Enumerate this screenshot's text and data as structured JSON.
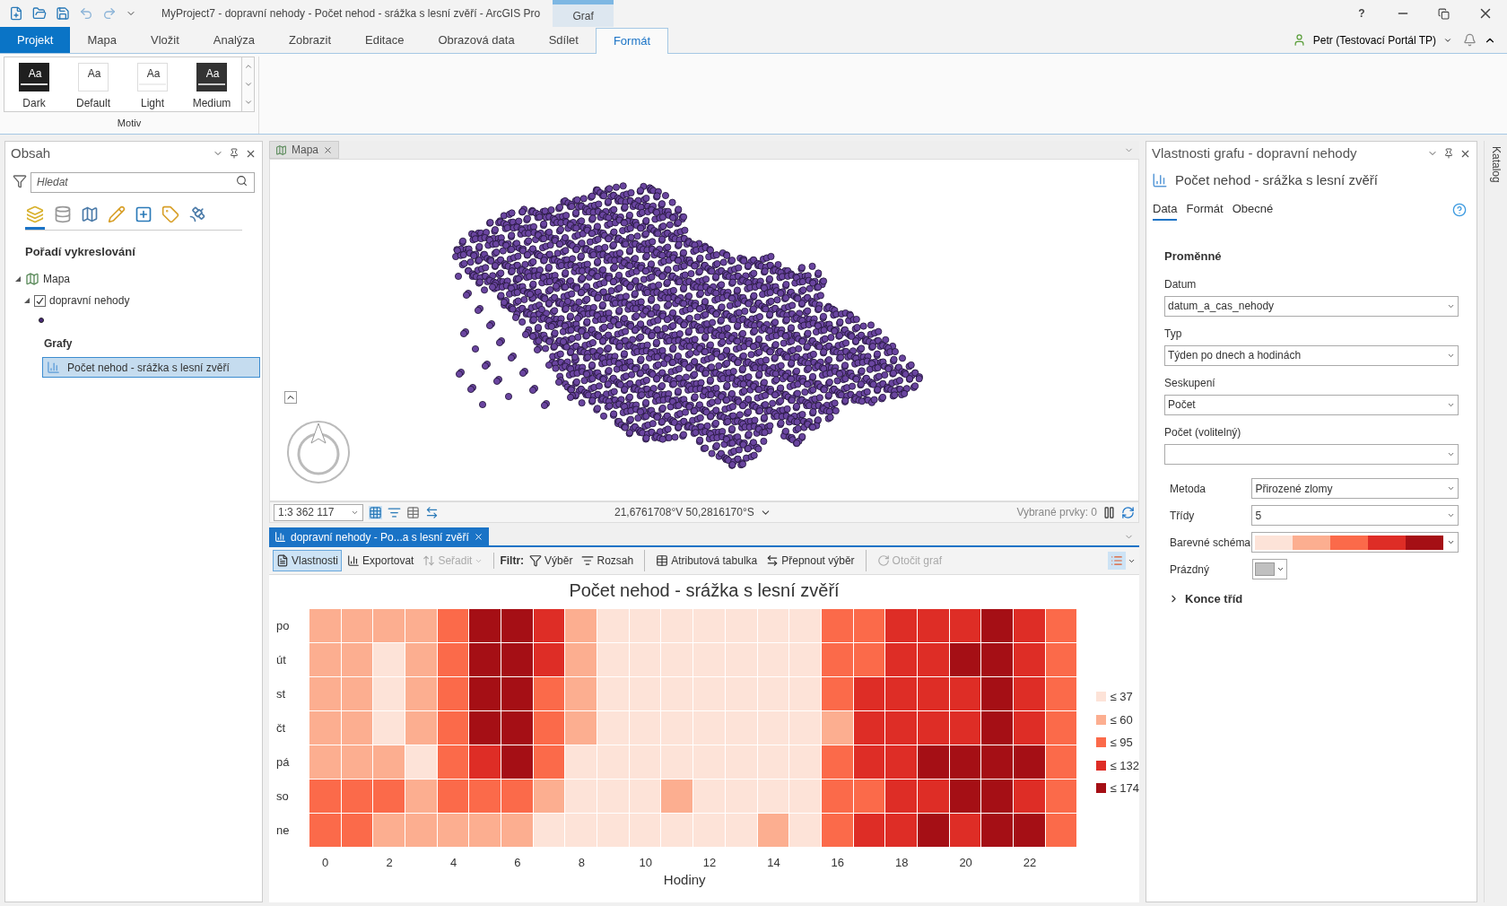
{
  "title_bar": {
    "title": "MyProject7 - dopravní nehody - Počet nehod - srážka s lesní zvěří - ArcGIS Pro",
    "context_tab": "Graf",
    "help": "?"
  },
  "ribbon": {
    "tabs": [
      {
        "label": "Projekt",
        "kind": "backstage",
        "selected": false
      },
      {
        "label": "Mapa",
        "kind": "tab",
        "selected": false
      },
      {
        "label": "Vložit",
        "kind": "tab",
        "selected": false
      },
      {
        "label": "Analýza",
        "kind": "tab",
        "selected": false
      },
      {
        "label": "Zobrazit",
        "kind": "tab",
        "selected": false
      },
      {
        "label": "Editace",
        "kind": "tab",
        "selected": false
      },
      {
        "label": "Obrazová data",
        "kind": "tab",
        "selected": false
      },
      {
        "label": "Sdílet",
        "kind": "tab",
        "selected": false
      },
      {
        "label": "Formát",
        "kind": "tab",
        "selected": true
      }
    ],
    "user": "Petr (Testovací Portál TP)",
    "themes": [
      {
        "sample": "Aa",
        "label": "Dark",
        "kind": "dark"
      },
      {
        "sample": "Aa",
        "label": "Default",
        "kind": "default"
      },
      {
        "sample": "Aa",
        "label": "Light",
        "kind": "light"
      },
      {
        "sample": "Aa",
        "label": "Medium",
        "kind": "medium"
      }
    ],
    "group_label": "Motiv"
  },
  "contents_pane": {
    "title": "Obsah",
    "search": {
      "placeholder": "Hledat"
    },
    "heading": "Pořadí vykreslování",
    "tree": [
      {
        "label": "Mapa",
        "expanded": true,
        "children": [
          {
            "label": "dopravní nehody",
            "checked": true,
            "expanded": true
          }
        ]
      }
    ],
    "charts_heading": "Grafy",
    "charts": [
      {
        "label": "Počet nehod - srážka s lesní zvěří",
        "selected": true
      }
    ]
  },
  "map_view": {
    "tab": "Mapa",
    "scale": "1:3 362 117",
    "coordinates": "21,6761708°V 50,2816170°S",
    "selected_features": "Vybrané prvky: 0"
  },
  "chart_view": {
    "tab": "dopravní nehody - Po...a s lesní zvěří",
    "toolbar": [
      {
        "label": "Vlastnosti",
        "kind": "button",
        "selected": true,
        "disabled": false
      },
      {
        "label": "Exportovat",
        "kind": "button",
        "selected": false,
        "disabled": false
      },
      {
        "label": "Seřadit",
        "kind": "dropdown",
        "selected": false,
        "disabled": true
      },
      {
        "label": "Filtr:",
        "kind": "label"
      },
      {
        "label": "Výběr",
        "kind": "button",
        "selected": false,
        "disabled": false
      },
      {
        "label": "Rozsah",
        "kind": "button",
        "selected": false,
        "disabled": false
      },
      {
        "label": "Atributová tabulka",
        "kind": "button",
        "selected": false,
        "disabled": false
      },
      {
        "label": "Přepnout výběr",
        "kind": "button",
        "selected": false,
        "disabled": false
      },
      {
        "label": "Otočit graf",
        "kind": "button",
        "selected": false,
        "disabled": true
      }
    ],
    "heatmap": {
      "title": "Počet nehod - srážka s lesní zvěří",
      "xlabel": "Hodiny",
      "xticks": [
        "0",
        "2",
        "4",
        "6",
        "8",
        "10",
        "12",
        "14",
        "16",
        "18",
        "20",
        "22"
      ],
      "legend": [
        {
          "label": "≤ 37",
          "color": "#fde3d8"
        },
        {
          "label": "≤ 60",
          "color": "#fcae90"
        },
        {
          "label": "≤ 95",
          "color": "#fb6a4a"
        },
        {
          "label": "≤ 132",
          "color": "#de2d26"
        },
        {
          "label": "≤ 174",
          "color": "#a50f15"
        }
      ],
      "rows": [
        {
          "label": "po",
          "cells": [
            {
              "color": "#fcae90"
            },
            {
              "color": "#fcae90"
            },
            {
              "color": "#fcae90"
            },
            {
              "color": "#fcae90"
            },
            {
              "color": "#fb6a4a"
            },
            {
              "color": "#a50f15"
            },
            {
              "color": "#a50f15"
            },
            {
              "color": "#de2d26"
            },
            {
              "color": "#fcae90"
            },
            {
              "color": "#fde3d8"
            },
            {
              "color": "#fde3d8"
            },
            {
              "color": "#fde3d8"
            },
            {
              "color": "#fde3d8"
            },
            {
              "color": "#fde3d8"
            },
            {
              "color": "#fde3d8"
            },
            {
              "color": "#fde3d8"
            },
            {
              "color": "#fb6a4a"
            },
            {
              "color": "#fb6a4a"
            },
            {
              "color": "#de2d26"
            },
            {
              "color": "#de2d26"
            },
            {
              "color": "#de2d26"
            },
            {
              "color": "#a50f15"
            },
            {
              "color": "#de2d26"
            },
            {
              "color": "#fb6a4a"
            }
          ]
        },
        {
          "label": "út",
          "cells": [
            {
              "color": "#fcae90"
            },
            {
              "color": "#fcae90"
            },
            {
              "color": "#fde3d8"
            },
            {
              "color": "#fcae90"
            },
            {
              "color": "#fb6a4a"
            },
            {
              "color": "#a50f15"
            },
            {
              "color": "#a50f15"
            },
            {
              "color": "#de2d26"
            },
            {
              "color": "#fcae90"
            },
            {
              "color": "#fde3d8"
            },
            {
              "color": "#fde3d8"
            },
            {
              "color": "#fde3d8"
            },
            {
              "color": "#fde3d8"
            },
            {
              "color": "#fde3d8"
            },
            {
              "color": "#fde3d8"
            },
            {
              "color": "#fde3d8"
            },
            {
              "color": "#fb6a4a"
            },
            {
              "color": "#fb6a4a"
            },
            {
              "color": "#de2d26"
            },
            {
              "color": "#de2d26"
            },
            {
              "color": "#a50f15"
            },
            {
              "color": "#a50f15"
            },
            {
              "color": "#de2d26"
            },
            {
              "color": "#fb6a4a"
            }
          ]
        },
        {
          "label": "st",
          "cells": [
            {
              "color": "#fcae90"
            },
            {
              "color": "#fcae90"
            },
            {
              "color": "#fde3d8"
            },
            {
              "color": "#fcae90"
            },
            {
              "color": "#fb6a4a"
            },
            {
              "color": "#a50f15"
            },
            {
              "color": "#a50f15"
            },
            {
              "color": "#fb6a4a"
            },
            {
              "color": "#fcae90"
            },
            {
              "color": "#fde3d8"
            },
            {
              "color": "#fde3d8"
            },
            {
              "color": "#fde3d8"
            },
            {
              "color": "#fde3d8"
            },
            {
              "color": "#fde3d8"
            },
            {
              "color": "#fde3d8"
            },
            {
              "color": "#fde3d8"
            },
            {
              "color": "#fb6a4a"
            },
            {
              "color": "#de2d26"
            },
            {
              "color": "#de2d26"
            },
            {
              "color": "#de2d26"
            },
            {
              "color": "#de2d26"
            },
            {
              "color": "#a50f15"
            },
            {
              "color": "#de2d26"
            },
            {
              "color": "#fb6a4a"
            }
          ]
        },
        {
          "label": "čt",
          "cells": [
            {
              "color": "#fcae90"
            },
            {
              "color": "#fcae90"
            },
            {
              "color": "#fde3d8"
            },
            {
              "color": "#fcae90"
            },
            {
              "color": "#fb6a4a"
            },
            {
              "color": "#a50f15"
            },
            {
              "color": "#a50f15"
            },
            {
              "color": "#fb6a4a"
            },
            {
              "color": "#fcae90"
            },
            {
              "color": "#fde3d8"
            },
            {
              "color": "#fde3d8"
            },
            {
              "color": "#fde3d8"
            },
            {
              "color": "#fde3d8"
            },
            {
              "color": "#fde3d8"
            },
            {
              "color": "#fde3d8"
            },
            {
              "color": "#fde3d8"
            },
            {
              "color": "#fcae90"
            },
            {
              "color": "#de2d26"
            },
            {
              "color": "#de2d26"
            },
            {
              "color": "#de2d26"
            },
            {
              "color": "#de2d26"
            },
            {
              "color": "#a50f15"
            },
            {
              "color": "#de2d26"
            },
            {
              "color": "#fb6a4a"
            }
          ]
        },
        {
          "label": "pá",
          "cells": [
            {
              "color": "#fcae90"
            },
            {
              "color": "#fcae90"
            },
            {
              "color": "#fcae90"
            },
            {
              "color": "#fde3d8"
            },
            {
              "color": "#fb6a4a"
            },
            {
              "color": "#de2d26"
            },
            {
              "color": "#a50f15"
            },
            {
              "color": "#fb6a4a"
            },
            {
              "color": "#fde3d8"
            },
            {
              "color": "#fde3d8"
            },
            {
              "color": "#fde3d8"
            },
            {
              "color": "#fde3d8"
            },
            {
              "color": "#fde3d8"
            },
            {
              "color": "#fde3d8"
            },
            {
              "color": "#fde3d8"
            },
            {
              "color": "#fde3d8"
            },
            {
              "color": "#fb6a4a"
            },
            {
              "color": "#de2d26"
            },
            {
              "color": "#de2d26"
            },
            {
              "color": "#a50f15"
            },
            {
              "color": "#a50f15"
            },
            {
              "color": "#a50f15"
            },
            {
              "color": "#a50f15"
            },
            {
              "color": "#fb6a4a"
            }
          ]
        },
        {
          "label": "so",
          "cells": [
            {
              "color": "#fb6a4a"
            },
            {
              "color": "#fb6a4a"
            },
            {
              "color": "#fb6a4a"
            },
            {
              "color": "#fcae90"
            },
            {
              "color": "#fb6a4a"
            },
            {
              "color": "#fb6a4a"
            },
            {
              "color": "#fb6a4a"
            },
            {
              "color": "#fcae90"
            },
            {
              "color": "#fde3d8"
            },
            {
              "color": "#fde3d8"
            },
            {
              "color": "#fde3d8"
            },
            {
              "color": "#fcae90"
            },
            {
              "color": "#fde3d8"
            },
            {
              "color": "#fde3d8"
            },
            {
              "color": "#fde3d8"
            },
            {
              "color": "#fde3d8"
            },
            {
              "color": "#fb6a4a"
            },
            {
              "color": "#fb6a4a"
            },
            {
              "color": "#de2d26"
            },
            {
              "color": "#de2d26"
            },
            {
              "color": "#a50f15"
            },
            {
              "color": "#a50f15"
            },
            {
              "color": "#de2d26"
            },
            {
              "color": "#fb6a4a"
            }
          ]
        },
        {
          "label": "ne",
          "cells": [
            {
              "color": "#fb6a4a"
            },
            {
              "color": "#fb6a4a"
            },
            {
              "color": "#fcae90"
            },
            {
              "color": "#fcae90"
            },
            {
              "color": "#fcae90"
            },
            {
              "color": "#fcae90"
            },
            {
              "color": "#fcae90"
            },
            {
              "color": "#fde3d8"
            },
            {
              "color": "#fde3d8"
            },
            {
              "color": "#fde3d8"
            },
            {
              "color": "#fde3d8"
            },
            {
              "color": "#fde3d8"
            },
            {
              "color": "#fde3d8"
            },
            {
              "color": "#fde3d8"
            },
            {
              "color": "#fcae90"
            },
            {
              "color": "#fde3d8"
            },
            {
              "color": "#fb6a4a"
            },
            {
              "color": "#de2d26"
            },
            {
              "color": "#de2d26"
            },
            {
              "color": "#a50f15"
            },
            {
              "color": "#de2d26"
            },
            {
              "color": "#a50f15"
            },
            {
              "color": "#a50f15"
            },
            {
              "color": "#fb6a4a"
            }
          ]
        }
      ]
    }
  },
  "properties_pane": {
    "title": "Vlastnosti grafu - dopravní nehody",
    "chart_name": "Počet nehod - srážka s lesní zvěří",
    "tabs": [
      {
        "label": "Data",
        "selected": true
      },
      {
        "label": "Formát",
        "selected": false
      },
      {
        "label": "Obecné",
        "selected": false
      }
    ],
    "section": "Proměnné",
    "fields": [
      {
        "label": "Datum",
        "value": "datum_a_cas_nehody"
      },
      {
        "label": "Typ",
        "value": "Týden po dnech a hodinách"
      },
      {
        "label": "Seskupení",
        "value": "Počet"
      },
      {
        "label": "Počet (volitelný)"
      }
    ],
    "classification": [
      {
        "label": "Metoda",
        "kind": "dropdown",
        "value": "Přirozené zlomy"
      },
      {
        "label": "Třídy",
        "kind": "dropdown",
        "value": "5"
      },
      {
        "label": "Barevné schéma",
        "kind": "ramp",
        "segments": [
          {
            "color": "#fde3d8"
          },
          {
            "color": "#fcae90"
          },
          {
            "color": "#fb6a4a"
          },
          {
            "color": "#de2d26"
          },
          {
            "color": "#a50f15"
          }
        ]
      },
      {
        "label": "Prázdný",
        "kind": "swatch",
        "color": "#c0c0c0"
      }
    ],
    "expander": {
      "label": "Konce tříd",
      "expanded": false
    }
  },
  "side_tab": "Katalog"
}
